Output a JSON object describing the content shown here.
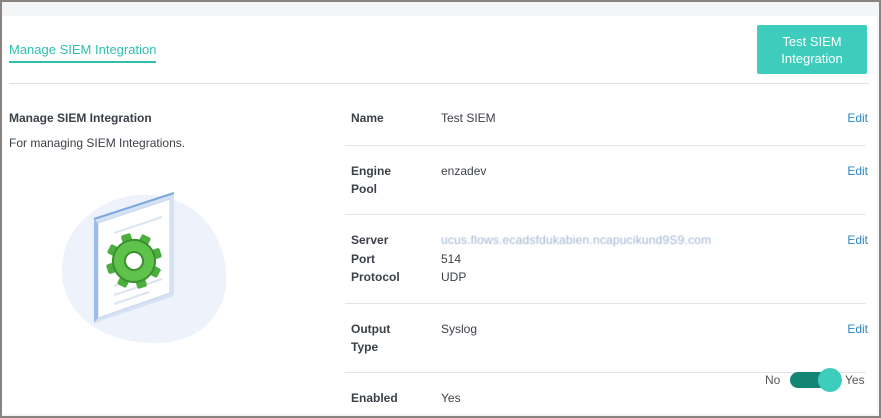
{
  "header": {
    "tab_label": "Manage SIEM Integration",
    "test_button": "Test SIEM Integration"
  },
  "left_panel": {
    "title": "Manage SIEM Integration",
    "description": "For managing SIEM Integrations."
  },
  "rows": {
    "name": {
      "label": "Name",
      "value": "Test SIEM",
      "edit": "Edit"
    },
    "engine_pool": {
      "label_line1": "Engine",
      "label_line2": "Pool",
      "value": "enzadev",
      "edit": "Edit"
    },
    "server": {
      "server_label": "Server",
      "server_value": "ucus.flows.ecadsfdukabien.ncapucikund9S9.com",
      "port_label": "Port",
      "port_value": "514",
      "protocol_label": "Protocol",
      "protocol_value": "UDP",
      "edit": "Edit"
    },
    "output_type": {
      "label_line1": "Output",
      "label_line2": "Type",
      "value": "Syslog",
      "edit": "Edit"
    },
    "enabled": {
      "label": "Enabled",
      "value": "Yes",
      "toggle_off": "No",
      "toggle_on": "Yes",
      "toggle_state": "on"
    }
  },
  "colors": {
    "accent": "#3ecdbd",
    "accent_dark": "#138577",
    "link": "#2b86c9"
  },
  "icons": {
    "illustration": "gear-document-illustration"
  }
}
